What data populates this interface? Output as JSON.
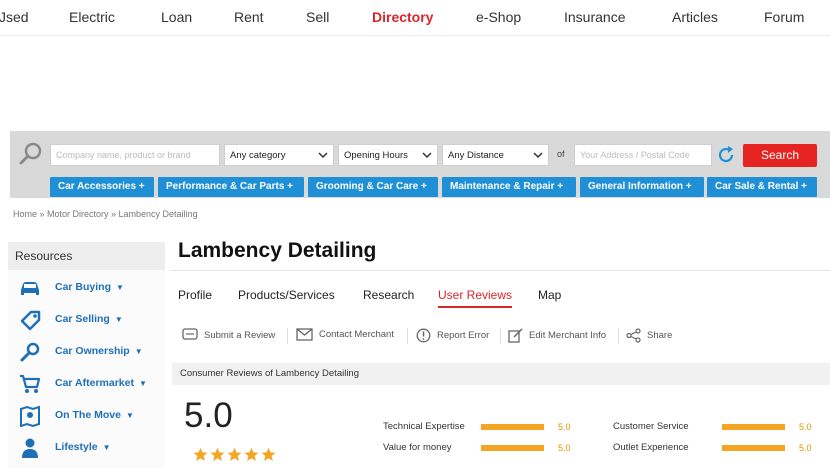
{
  "nav": {
    "items": [
      "Jsed",
      "Electric",
      "Loan",
      "Rent",
      "Sell",
      "Directory",
      "e-Shop",
      "Insurance",
      "Articles",
      "Forum"
    ],
    "active": "Directory"
  },
  "search": {
    "query_placeholder": "Company name, product or brand",
    "category": "Any category",
    "hours": "Opening Hours",
    "distance": "Any Distance",
    "of_label": "of",
    "address_placeholder": "Your Address / Postal Code",
    "button": "Search"
  },
  "categories": [
    "Car Accessories +",
    "Performance & Car Parts +",
    "Grooming & Car Care +",
    "Maintenance & Repair +",
    "General Information +",
    "Car Sale & Rental +"
  ],
  "breadcrumb": "Home » Motor Directory » Lambency Detailing",
  "sidebar": {
    "heading": "Resources",
    "items": [
      {
        "label": "Car Buying",
        "icon": "car-icon"
      },
      {
        "label": "Car Selling",
        "icon": "price-tag-icon"
      },
      {
        "label": "Car Ownership",
        "icon": "key-icon"
      },
      {
        "label": "Car Aftermarket",
        "icon": "shopping-cart-icon"
      },
      {
        "label": "On The Move",
        "icon": "map-icon"
      },
      {
        "label": "Lifestyle",
        "icon": "person-icon"
      }
    ]
  },
  "merchant": {
    "title": "Lambency Detailing",
    "tabs": [
      "Profile",
      "Products/Services",
      "Research",
      "User Reviews",
      "Map"
    ],
    "active_tab": "User Reviews"
  },
  "actions": [
    "Submit a Review",
    "Contact Merchant",
    "Report Error",
    "Edit Merchant Info",
    "Share"
  ],
  "reviews": {
    "heading": "Consumer Reviews of Lambency Detailing",
    "score": "5.0",
    "stars": 5,
    "metrics": [
      {
        "label": "Technical Expertise",
        "value": "5.0"
      },
      {
        "label": "Customer Service",
        "value": "5.0"
      },
      {
        "label": "Value for money",
        "value": "5.0"
      },
      {
        "label": "Outlet Experience",
        "value": "5.0"
      }
    ]
  },
  "colors": {
    "accent_red": "#e52421",
    "category_blue": "#1f90d6",
    "link_blue": "#1f6fb6",
    "star_orange": "#f5a524"
  }
}
